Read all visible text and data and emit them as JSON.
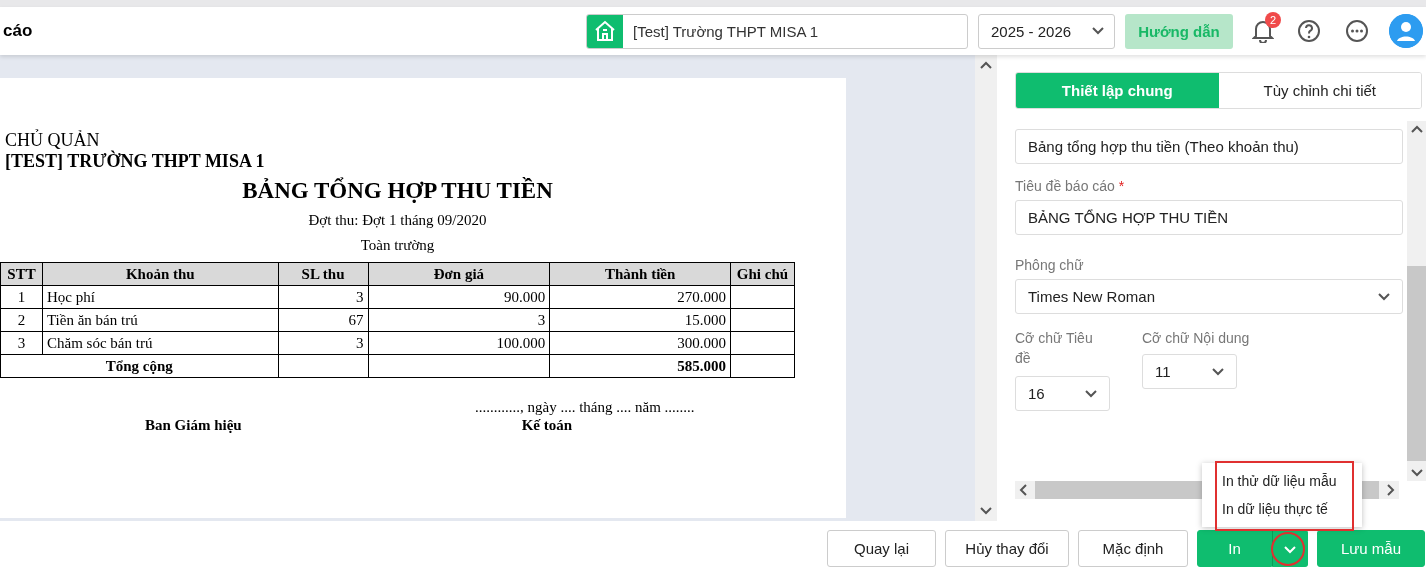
{
  "header": {
    "title": "cáo",
    "school": "[Test] Trường THPT MISA 1",
    "year": "2025 - 2026",
    "guide_button": "Hướng dẫn",
    "notification_count": "2"
  },
  "report": {
    "org": "CHỦ QUẢN",
    "school": "[TEST] TRƯỜNG THPT MISA 1",
    "title": "BẢNG TỔNG HỢP THU TIỀN",
    "period": "Đợt thu: Đợt 1 tháng 09/2020",
    "scope": "Toàn trường",
    "columns": [
      "STT",
      "Khoản thu",
      "SL thu",
      "Đơn giá",
      "Thành tiền",
      "Ghi chú"
    ],
    "rows": [
      [
        "1",
        "Học phí",
        "3",
        "90.000",
        "270.000"
      ],
      [
        "2",
        "Tiền ăn bán trú",
        "67",
        "3",
        "15.000"
      ],
      [
        "3",
        "Chăm sóc bán trú",
        "3",
        "100.000",
        "300.000"
      ]
    ],
    "total": {
      "label": "Tổng cộng",
      "amount": "585.000"
    },
    "date_line": "............, ngày .... tháng .... năm ........",
    "signers": [
      "Ban Giám hiệu",
      "Kế toán"
    ]
  },
  "settings": {
    "tabs": [
      {
        "label": "Thiết lập chung",
        "selected": true
      },
      {
        "label": "Tùy chỉnh chi tiết",
        "selected": false
      }
    ],
    "template_name": "Bảng tổng hợp thu tiền (Theo khoản thu)",
    "report_title": {
      "label": "Tiêu đề báo cáo",
      "required_mark": "*",
      "value": "BẢNG TỔNG HỢP THU TIỀN"
    },
    "font": {
      "label": "Phông chữ",
      "value": "Times New Roman"
    },
    "title_size": {
      "label": "Cỡ chữ Tiêu đề",
      "value": "16"
    },
    "content_size": {
      "label": "Cỡ chữ Nội dung",
      "value": "11"
    }
  },
  "footer": {
    "buttons": [
      "Quay lại",
      "Hủy thay đổi",
      "Mặc định"
    ],
    "print_button": "In",
    "save_button": "Lưu mẫu"
  },
  "print_menu": {
    "items": [
      "In thử dữ liệu mẫu",
      "In dữ liệu thực tế"
    ]
  }
}
